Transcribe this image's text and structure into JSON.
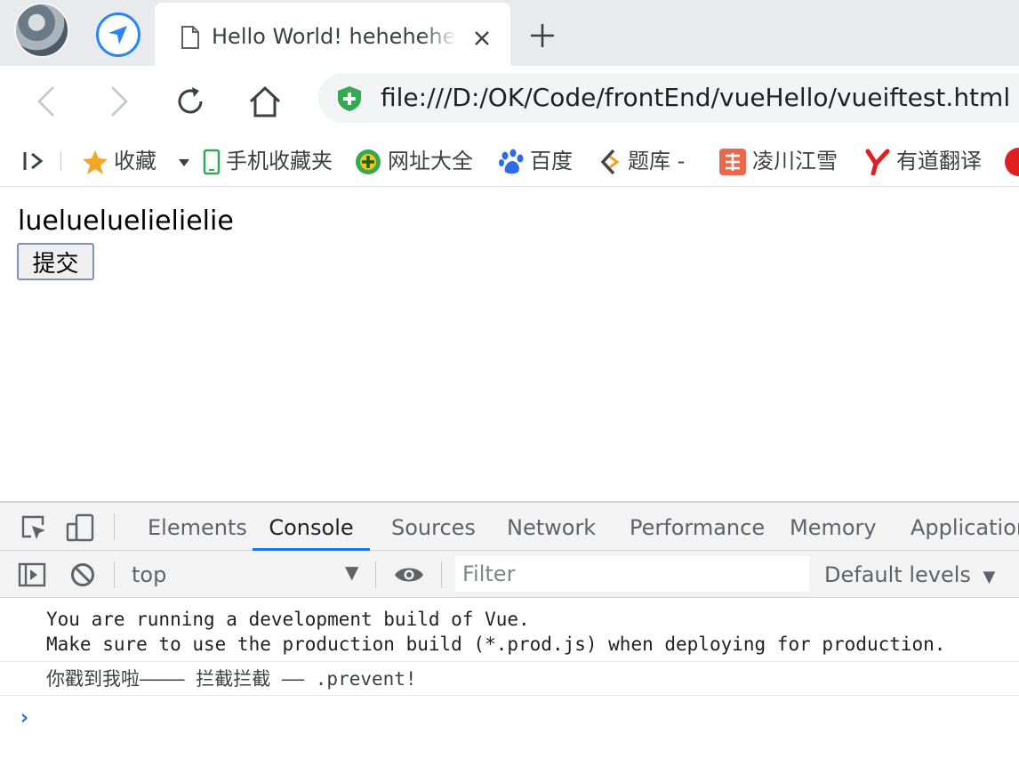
{
  "browser": {
    "tab_title": "Hello World! hehehehehe",
    "url": "file:///D:/OK/Code/frontEnd/vueHello/vueiftest.html"
  },
  "bookmarks": [
    {
      "label": "收藏",
      "icon": "star-icon"
    },
    {
      "label": "手机收藏夹",
      "icon": "phone-icon"
    },
    {
      "label": "网址大全",
      "icon": "plus-circle-icon"
    },
    {
      "label": "百度",
      "icon": "paw-icon"
    },
    {
      "label": "题库 -",
      "icon": "bookmark-icon"
    },
    {
      "label": "凌川江雪",
      "icon": "jian-icon"
    },
    {
      "label": "有道翻译",
      "icon": "youdao-icon"
    }
  ],
  "page": {
    "message": "luelueluelielielie",
    "submit_label": "提交"
  },
  "devtools": {
    "tabs": [
      "Elements",
      "Console",
      "Sources",
      "Network",
      "Performance",
      "Memory",
      "Application"
    ],
    "active_tab": "Console",
    "context": "top",
    "filter_placeholder": "Filter",
    "levels": "Default levels",
    "console_lines": [
      "You are running a development build of Vue.",
      "Make sure to use the production build (*.prod.js) when deploying for production.",
      "你戳到我啦———— 拦截拦截 —— .prevent!"
    ],
    "prompt": "›"
  },
  "colors": {
    "accent": "#1a73e8",
    "tabstrip": "#e8eaed",
    "shield": "#34a853"
  }
}
